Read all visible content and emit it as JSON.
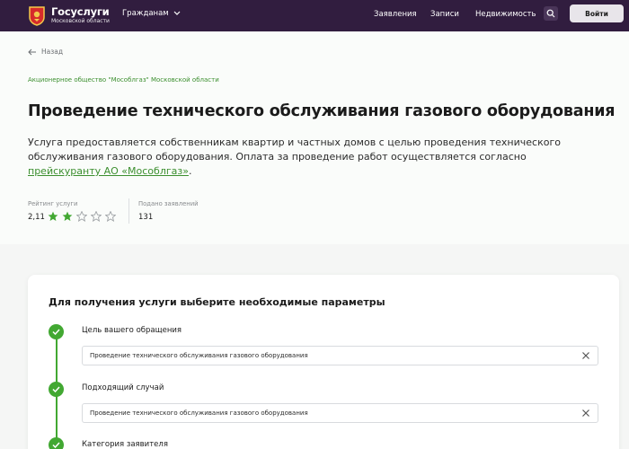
{
  "header": {
    "brand_title": "Госуслуги",
    "brand_subtitle": "Московской области",
    "audience": "Гражданам",
    "nav": [
      "Заявления",
      "Записи",
      "Недвижимость"
    ],
    "login_label": "Войти"
  },
  "hero": {
    "back_label": "Назад",
    "organization": "Акционерное общество \"Мособлгаз\" Московской области",
    "title": "Проведение технического обслуживания газового оборудования",
    "description_text": "Услуга предоставляется собственникам квартир и частных домов с целью проведения технического обслуживания газового оборудования. Оплата за проведение работ осуществляется согласно ",
    "description_link": "прейскуранту АО «Мособлгаз»",
    "description_end": ".",
    "rating_label": "Рейтинг услуги",
    "rating_value": "2,11",
    "rating_stars_filled": 2,
    "rating_stars_total": 5,
    "applications_label": "Подано заявлений",
    "applications_value": "131"
  },
  "form": {
    "title": "Для получения услуги выберите необходимые параметры",
    "steps": [
      {
        "label": "Цель вашего обращения",
        "value": "Проведение технического обслуживания газового оборудования"
      },
      {
        "label": "Подходящий случай",
        "value": "Проведение технического обслуживания газового оборудования"
      },
      {
        "label": "Категория заявителя"
      }
    ]
  },
  "colors": {
    "header_bg": "#311d3f",
    "accent_green": "#42a832",
    "link_green": "#3c8f2f"
  }
}
